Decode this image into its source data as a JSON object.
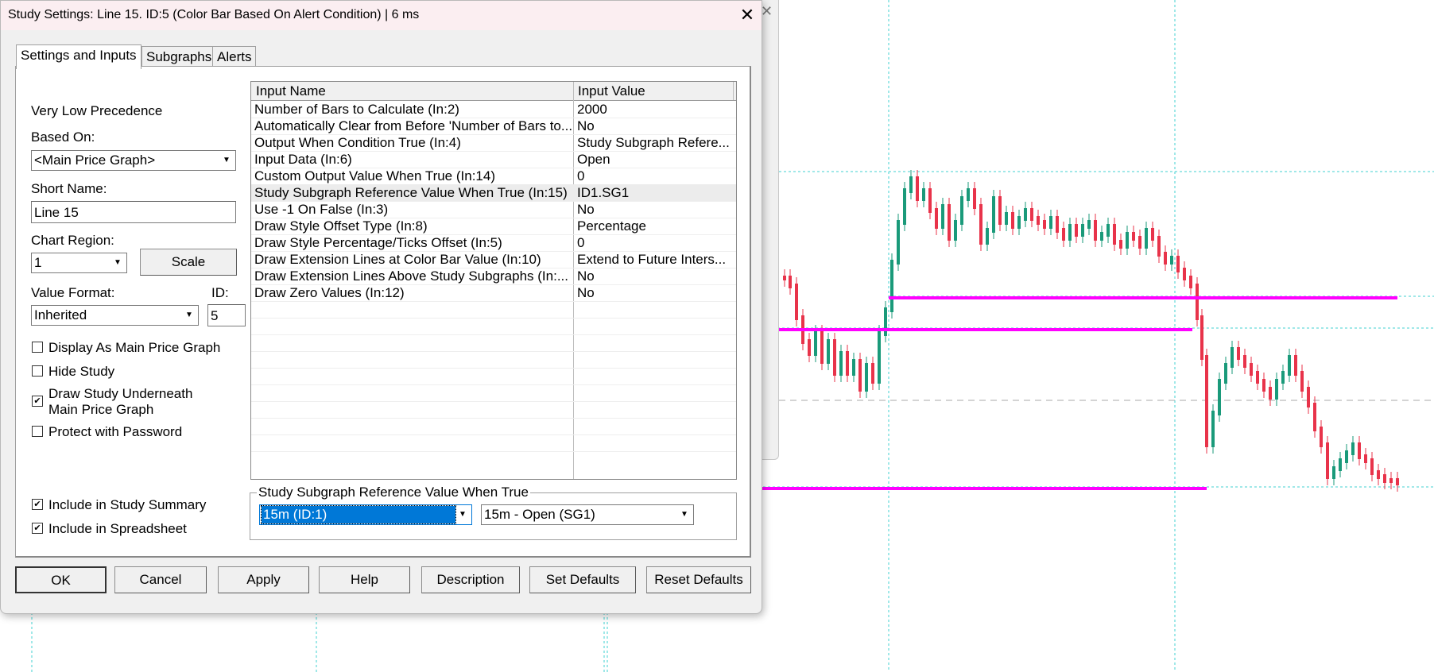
{
  "dialog": {
    "title": "Study Settings: Line 15. ID:5 (Color Bar Based On Alert Condition) | 6 ms",
    "close_symbol": "✕",
    "tabs": [
      {
        "label": "Settings and Inputs",
        "active": true
      },
      {
        "label": "Subgraphs",
        "active": false
      },
      {
        "label": "Alerts",
        "active": false
      }
    ]
  },
  "settings": {
    "precedence": "Very Low Precedence",
    "based_on_label": "Based On:",
    "based_on_value": "<Main Price Graph>",
    "short_name_label": "Short Name:",
    "short_name_value": "Line 15",
    "chart_region_label": "Chart Region:",
    "chart_region_value": "1",
    "scale_button": "Scale",
    "value_format_label": "Value Format:",
    "value_format_value": "Inherited",
    "id_label": "ID:",
    "id_value": "5",
    "checkboxes": [
      {
        "label": "Display As Main Price Graph",
        "checked": false
      },
      {
        "label": "Hide Study",
        "checked": false
      },
      {
        "label": "Draw Study Underneath",
        "label2": "Main Price Graph",
        "checked": true
      },
      {
        "label": "Protect with Password",
        "checked": false
      }
    ],
    "bottom_checkboxes": [
      {
        "label": "Include in Study Summary",
        "checked": true
      },
      {
        "label": "Include in Spreadsheet",
        "checked": true
      }
    ],
    "check_mark": "✔"
  },
  "inputs_table": {
    "headers": [
      "Input Name",
      "Input Value"
    ],
    "rows": [
      {
        "name": "Number of Bars to Calculate   (In:2)",
        "value": "2000"
      },
      {
        "name": "Automatically Clear from Before 'Number of Bars to...",
        "value": "No"
      },
      {
        "name": "Output When Condition True   (In:4)",
        "value": "Study Subgraph Refere..."
      },
      {
        "name": "Input Data   (In:6)",
        "value": "Open"
      },
      {
        "name": "Custom Output Value When True   (In:14)",
        "value": "0"
      },
      {
        "name": "Study Subgraph Reference Value When True   (In:15)",
        "value": "ID1.SG1",
        "selected": true
      },
      {
        "name": "Use -1 On False   (In:3)",
        "value": "No"
      },
      {
        "name": "Draw Style Offset Type   (In:8)",
        "value": "Percentage"
      },
      {
        "name": "Draw Style Percentage/Ticks Offset   (In:5)",
        "value": "0"
      },
      {
        "name": "Draw Extension Lines at Color Bar Value   (In:10)",
        "value": "Extend to Future Inters..."
      },
      {
        "name": "Draw Extension Lines Above Study Subgraphs   (In:...",
        "value": "No"
      },
      {
        "name": "Draw Zero Values   (In:12)",
        "value": "No"
      }
    ]
  },
  "reference_group": {
    "title": "Study Subgraph Reference Value When True",
    "study_value": "15m (ID:1)",
    "subgraph_value": "15m - Open (SG1)"
  },
  "buttons": {
    "ok": "OK",
    "cancel": "Cancel",
    "apply": "Apply",
    "help": "Help",
    "description": "Description",
    "set_defaults": "Set Defaults",
    "reset_defaults": "Reset Defaults"
  },
  "colors": {
    "up_candle": "#1a9a7a",
    "down_candle": "#e8334a",
    "extension_line": "#ff00ff",
    "grid_line": "#40d0d0",
    "selection": "#0078d7"
  },
  "icons": {
    "close": "close-icon",
    "dropdown": "chevron-down-icon",
    "checkbox": "checkbox-check-icon"
  }
}
